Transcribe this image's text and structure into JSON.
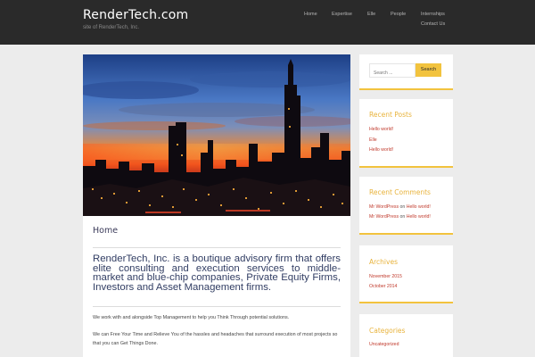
{
  "header": {
    "site_title": "RenderTech.com",
    "tagline": "site of RenderTech, Inc.",
    "nav": [
      "Home",
      "Expertise",
      "Elle",
      "People",
      "Internships",
      "Contact Us"
    ]
  },
  "main": {
    "page_title": "Home",
    "lead": "RenderTech, Inc. is a boutique advisory firm that offers elite consulting and execution services to middle-market and blue-chip companies, Private Equity Firms, Investors and Asset Management firms.",
    "paragraphs": [
      "We work with and alongside Top Management to help you Think Through potential solutions.",
      "We can Free Your Time and Relieve You of the hassles and headaches that surround execution of most projects so that you can Get Things Done."
    ]
  },
  "sidebar": {
    "search": {
      "placeholder": "Search ...",
      "button": "Search"
    },
    "recent_posts": {
      "title": "Recent Posts",
      "items": [
        "Hello world!",
        "Elle",
        "Hello world!"
      ]
    },
    "recent_comments": {
      "title": "Recent Comments",
      "items": [
        {
          "author": "Mr WordPress",
          "on": "on",
          "post": "Hello world!"
        },
        {
          "author": "Mr WordPress",
          "on": "on",
          "post": "Hello world!"
        }
      ]
    },
    "archives": {
      "title": "Archives",
      "items": [
        "November 2015",
        "October 2014"
      ]
    },
    "categories": {
      "title": "Categories",
      "items": [
        "Uncategorized"
      ]
    }
  },
  "colors": {
    "header_bg": "#2a2a2a",
    "accent": "#f2c33e",
    "link": "#c0392b",
    "widget_title": "#e8b33c",
    "lead_text": "#313d63"
  }
}
